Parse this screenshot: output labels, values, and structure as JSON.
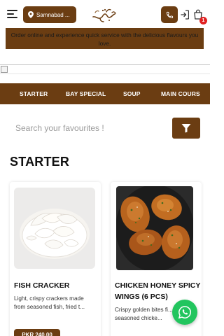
{
  "header": {
    "location_label": "Samnabad ...",
    "cart_count": "1"
  },
  "announcement": "Order online and experience quick service with the delicious flavours you love.",
  "categories": [
    "STARTER",
    "BAY SPECIAL",
    "SOUP",
    "MAIN COURS"
  ],
  "search": {
    "placeholder": "Search your favourites !"
  },
  "section": {
    "title": "STARTER"
  },
  "products": [
    {
      "name": "FISH CRACKER",
      "description": "Light, crispy crackers made from seasoned fish, fried t...",
      "price": "PKR 240.00"
    },
    {
      "name": "CHICKEN HONEY SPICY WINGS (6 PCS)",
      "description": "Crispy golden bites fi... with seasoned chicke..."
    }
  ],
  "colors": {
    "brand": "#6b3d12",
    "badge": "#e02020",
    "whatsapp": "#22c55e"
  },
  "icons": [
    "hamburger-menu-icon",
    "location-pin-icon",
    "phone-icon",
    "login-icon",
    "cart-icon",
    "filter-icon",
    "whatsapp-icon"
  ]
}
